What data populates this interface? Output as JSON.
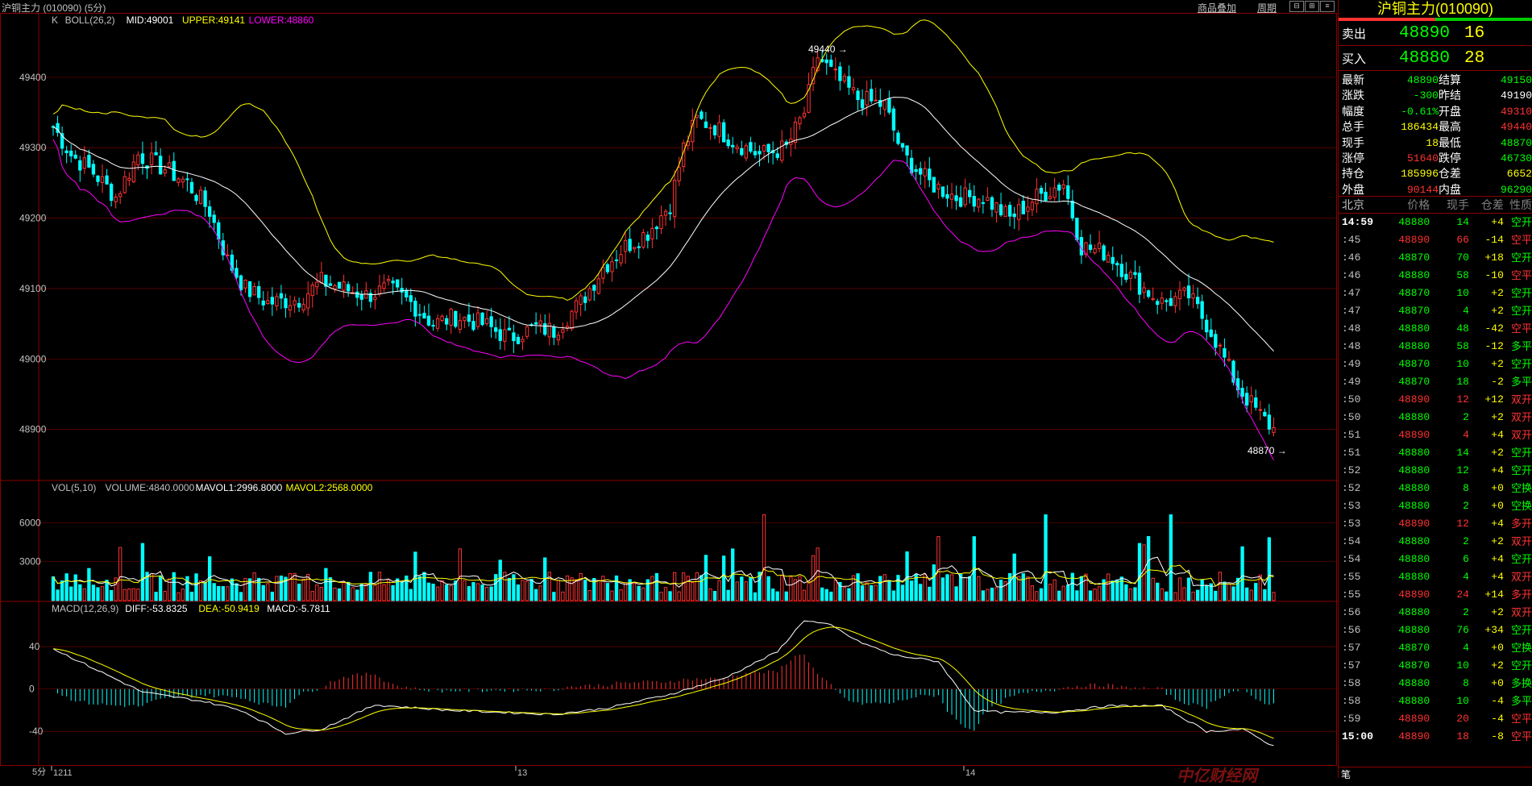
{
  "header": {
    "title": "沪铜主力 (010090) (5分)",
    "actions": [
      "商品叠加",
      "周期"
    ]
  },
  "panels": {
    "price": {
      "legend_prefix": "K",
      "legend": "BOLL(26,2)",
      "mid": "MID:49001",
      "upper": "UPPER:49141",
      "lower": "LOWER:48860",
      "ticks": [
        "49400",
        "49300",
        "49200",
        "49100",
        "49000",
        "48900"
      ],
      "high_label": "49440",
      "low_label": "48870"
    },
    "volume": {
      "legend": "VOL(5,10)",
      "volume": "VOLUME:4840.0000",
      "mavol1": "MAVOL1:2996.8000",
      "mavol2": "MAVOL2:2568.0000",
      "ticks": [
        "6000",
        "3000"
      ]
    },
    "macd": {
      "legend": "MACD(12,26,9)",
      "diff": "DIFF:-53.8325",
      "dea": "DEA:-50.9419",
      "macd": "MACD:-5.7811",
      "ticks": [
        "40",
        "0",
        "-40"
      ]
    },
    "xaxis": {
      "period": "5分",
      "labels": [
        "1211",
        "13",
        "14"
      ]
    }
  },
  "colors": {
    "up": "#ff3232",
    "down": "#00ffff",
    "upper": "#ffff00",
    "mid": "#ffffff",
    "lower": "#ff00ff",
    "grid": "#8b0000",
    "mavol1": "#ffffff",
    "mavol2": "#ffff00"
  },
  "chart_data": {
    "type": "candlestick",
    "ylim": [
      48840,
      49480
    ],
    "anchors": [
      [
        0,
        49330
      ],
      [
        4,
        49290
      ],
      [
        9,
        49265
      ],
      [
        14,
        49230
      ],
      [
        19,
        49290
      ],
      [
        25,
        49270
      ],
      [
        30,
        49250
      ],
      [
        35,
        49210
      ],
      [
        39,
        49140
      ],
      [
        43,
        49100
      ],
      [
        48,
        49080
      ],
      [
        55,
        49085
      ],
      [
        60,
        49110
      ],
      [
        65,
        49100
      ],
      [
        70,
        49090
      ],
      [
        75,
        49100
      ],
      [
        80,
        49080
      ],
      [
        85,
        49050
      ],
      [
        90,
        49060
      ],
      [
        96,
        49050
      ],
      [
        102,
        49030
      ],
      [
        108,
        49045
      ],
      [
        112,
        49040
      ],
      [
        118,
        49080
      ],
      [
        123,
        49130
      ],
      [
        128,
        49160
      ],
      [
        133,
        49180
      ],
      [
        138,
        49220
      ],
      [
        141,
        49300
      ],
      [
        144,
        49340
      ],
      [
        148,
        49330
      ],
      [
        152,
        49310
      ],
      [
        158,
        49290
      ],
      [
        164,
        49300
      ],
      [
        168,
        49350
      ],
      [
        171,
        49430
      ],
      [
        175,
        49400
      ],
      [
        180,
        49370
      ],
      [
        186,
        49360
      ],
      [
        190,
        49290
      ],
      [
        196,
        49250
      ],
      [
        202,
        49230
      ],
      [
        208,
        49230
      ],
      [
        214,
        49200
      ],
      [
        220,
        49230
      ],
      [
        226,
        49250
      ],
      [
        230,
        49160
      ],
      [
        236,
        49150
      ],
      [
        242,
        49110
      ],
      [
        248,
        49080
      ],
      [
        254,
        49090
      ],
      [
        259,
        49040
      ],
      [
        265,
        48960
      ],
      [
        270,
        48920
      ],
      [
        273,
        48900
      ]
    ],
    "macd_points": [
      [
        0,
        38
      ],
      [
        20,
        -3
      ],
      [
        34,
        -12
      ],
      [
        42,
        -20
      ],
      [
        52,
        -42
      ],
      [
        60,
        -38
      ],
      [
        72,
        -15
      ],
      [
        88,
        -20
      ],
      [
        100,
        -22
      ],
      [
        112,
        -24
      ],
      [
        124,
        -18
      ],
      [
        138,
        -5
      ],
      [
        150,
        10
      ],
      [
        162,
        35
      ],
      [
        168,
        65
      ],
      [
        174,
        60
      ],
      [
        180,
        45
      ],
      [
        188,
        32
      ],
      [
        198,
        26
      ],
      [
        206,
        -20
      ],
      [
        212,
        -22
      ],
      [
        224,
        -22
      ],
      [
        236,
        -16
      ],
      [
        248,
        -16
      ],
      [
        258,
        -40
      ],
      [
        266,
        -38
      ],
      [
        273,
        -54
      ]
    ]
  },
  "quote_panel": {
    "title": "沪铜主力(010090)",
    "sell_label": "卖出",
    "sell_price": "48890",
    "sell_vol": "16",
    "buy_label": "买入",
    "buy_price": "48880",
    "buy_vol": "28",
    "stats": [
      {
        "k": "最新",
        "v": "48890",
        "c": "#00ff00",
        "k2": "结算",
        "v2": "49150",
        "c2": "#00ff00"
      },
      {
        "k": "涨跌",
        "v": "-300",
        "c": "#00ff00",
        "k2": "昨结",
        "v2": "49190",
        "c2": "#ffffff"
      },
      {
        "k": "幅度",
        "v": "-0.61%",
        "c": "#00ff00",
        "k2": "开盘",
        "v2": "49310",
        "c2": "#ff3232"
      },
      {
        "k": "总手",
        "v": "186434",
        "c": "#ffff00",
        "k2": "最高",
        "v2": "49440",
        "c2": "#ff3232"
      },
      {
        "k": "现手",
        "v": "18",
        "c": "#ffff00",
        "k2": "最低",
        "v2": "48870",
        "c2": "#00ff00"
      },
      {
        "k": "涨停",
        "v": "51640",
        "c": "#ff3232",
        "k2": "跌停",
        "v2": "46730",
        "c2": "#00ff00"
      },
      {
        "k": "持仓",
        "v": "185996",
        "c": "#ffff00",
        "k2": "仓差",
        "v2": "6652",
        "c2": "#ffff00"
      },
      {
        "k": "外盘",
        "v": "90144",
        "c": "#ff3232",
        "k2": "内盘",
        "v2": "96290",
        "c2": "#00ff00"
      }
    ],
    "tick_head": [
      "北京",
      "价格",
      "现手",
      "仓差",
      "性质"
    ],
    "ticks": [
      {
        "t": "14:59",
        "p": "48880",
        "v": "14",
        "d": "+4",
        "n": "空开"
      },
      {
        "t": ":45",
        "p": "48890",
        "v": "66",
        "d": "-14",
        "n": "空平"
      },
      {
        "t": ":46",
        "p": "48870",
        "v": "70",
        "d": "+18",
        "n": "空开"
      },
      {
        "t": ":46",
        "p": "48880",
        "v": "58",
        "d": "-10",
        "n": "空平"
      },
      {
        "t": ":47",
        "p": "48870",
        "v": "10",
        "d": "+2",
        "n": "空开"
      },
      {
        "t": ":47",
        "p": "48870",
        "v": "4",
        "d": "+2",
        "n": "空开"
      },
      {
        "t": ":48",
        "p": "48880",
        "v": "48",
        "d": "-42",
        "n": "空平"
      },
      {
        "t": ":48",
        "p": "48880",
        "v": "58",
        "d": "-12",
        "n": "多平"
      },
      {
        "t": ":49",
        "p": "48870",
        "v": "10",
        "d": "+2",
        "n": "空开"
      },
      {
        "t": ":49",
        "p": "48870",
        "v": "18",
        "d": "-2",
        "n": "多平"
      },
      {
        "t": ":50",
        "p": "48890",
        "v": "12",
        "d": "+12",
        "n": "双开"
      },
      {
        "t": ":50",
        "p": "48880",
        "v": "2",
        "d": "+2",
        "n": "双开"
      },
      {
        "t": ":51",
        "p": "48890",
        "v": "4",
        "d": "+4",
        "n": "双开"
      },
      {
        "t": ":51",
        "p": "48880",
        "v": "14",
        "d": "+2",
        "n": "空开"
      },
      {
        "t": ":52",
        "p": "48880",
        "v": "12",
        "d": "+4",
        "n": "空开"
      },
      {
        "t": ":52",
        "p": "48880",
        "v": "8",
        "d": "+0",
        "n": "空换"
      },
      {
        "t": ":53",
        "p": "48880",
        "v": "2",
        "d": "+0",
        "n": "空换"
      },
      {
        "t": ":53",
        "p": "48890",
        "v": "12",
        "d": "+4",
        "n": "多开"
      },
      {
        "t": ":54",
        "p": "48880",
        "v": "2",
        "d": "+2",
        "n": "双开"
      },
      {
        "t": ":54",
        "p": "48880",
        "v": "6",
        "d": "+4",
        "n": "空开"
      },
      {
        "t": ":55",
        "p": "48880",
        "v": "4",
        "d": "+4",
        "n": "双开"
      },
      {
        "t": ":55",
        "p": "48890",
        "v": "24",
        "d": "+14",
        "n": "多开"
      },
      {
        "t": ":56",
        "p": "48880",
        "v": "2",
        "d": "+2",
        "n": "双开"
      },
      {
        "t": ":56",
        "p": "48880",
        "v": "76",
        "d": "+34",
        "n": "空开"
      },
      {
        "t": ":57",
        "p": "48870",
        "v": "4",
        "d": "+0",
        "n": "空换"
      },
      {
        "t": ":57",
        "p": "48870",
        "v": "10",
        "d": "+2",
        "n": "空开"
      },
      {
        "t": ":58",
        "p": "48880",
        "v": "8",
        "d": "+0",
        "n": "多换"
      },
      {
        "t": ":58",
        "p": "48880",
        "v": "10",
        "d": "-4",
        "n": "多平"
      },
      {
        "t": ":59",
        "p": "48890",
        "v": "20",
        "d": "-4",
        "n": "空平"
      },
      {
        "t": "15:00",
        "p": "48890",
        "v": "18",
        "d": "-8",
        "n": "空平"
      }
    ],
    "bottom_tab": "笔",
    "watermark": "中亿财经网"
  }
}
